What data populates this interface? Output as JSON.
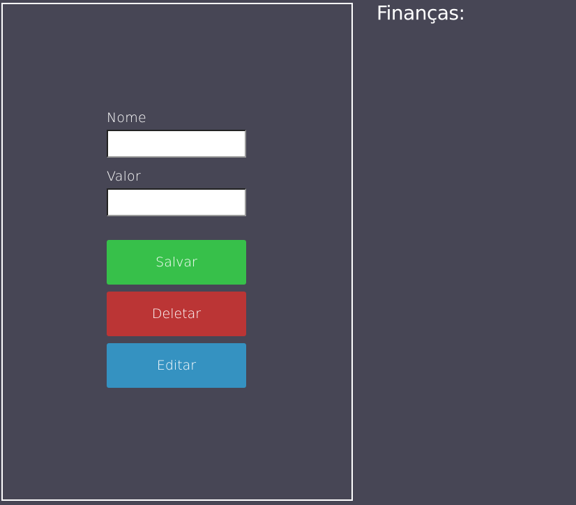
{
  "form": {
    "name_label": "Nome",
    "name_value": "",
    "value_label": "Valor",
    "value_value": "",
    "buttons": {
      "save_label": "Salvar",
      "delete_label": "Deletar",
      "edit_label": "Editar"
    }
  },
  "finance": {
    "title": "Finanças:"
  },
  "colors": {
    "background": "#474655",
    "save": "#37c04a",
    "delete": "#bb3535",
    "edit": "#3592c1"
  }
}
